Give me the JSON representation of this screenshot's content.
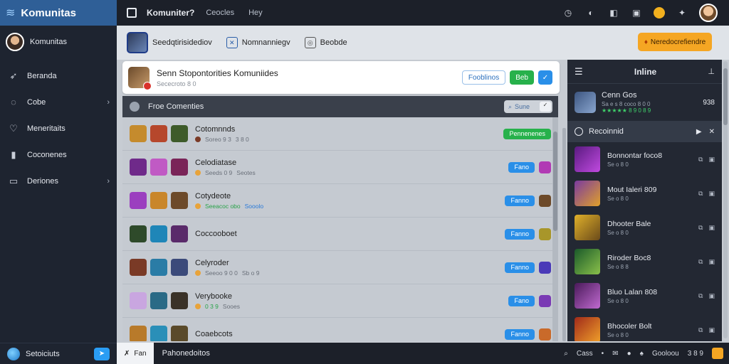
{
  "sidebar": {
    "brand": "Komunitas",
    "user_name": "Komunitas",
    "items": [
      {
        "label": "Beranda",
        "icon": "rocket-icon",
        "chevron": false
      },
      {
        "label": "Cobe",
        "icon": "chat-icon",
        "chevron": true
      },
      {
        "label": "Meneritaits",
        "icon": "heart-icon",
        "chevron": false
      },
      {
        "label": "Coconenes",
        "icon": "chart-icon",
        "chevron": false
      },
      {
        "label": "Deriones",
        "icon": "folder-icon",
        "chevron": true
      }
    ],
    "footer_label": "Setoiciuts"
  },
  "topbar": {
    "title": "Komuniter?",
    "link1": "Ceocles",
    "link2": "Hey"
  },
  "toolbar": {
    "item1": "Seedqtirisidediov",
    "item2": "Nomnanniegv",
    "item3": "Beobde",
    "cta_label": "Neredocrefiendre"
  },
  "community": {
    "title": "Senn Stopontorities Komuniides",
    "subtitle": "Sececroto 8 0",
    "btn_outline": "Fooblinos",
    "btn_green": "Beb",
    "btn_check": "✓"
  },
  "friends": {
    "header": "Froe Comenties",
    "search_placeholder": "Sune",
    "rows": [
      {
        "name": "Cotomnnds",
        "meta": [
          "Soreo 9 3",
          "3 8 0"
        ],
        "button": "Pennenenes",
        "button_type": "green",
        "games": [
          "#c58b2d",
          "#b6472c",
          "#3e5b2a"
        ],
        "mini": ""
      },
      {
        "name": "Celodiatase",
        "meta": [
          "Seeds 0 9",
          "Seotes"
        ],
        "button": "Fano",
        "button_type": "blue",
        "games": [
          "#6f2a8a",
          "#c05ac4",
          "#7a2458"
        ],
        "mini": "#b13ab4"
      },
      {
        "name": "Cotydeote",
        "meta": [
          "Seeacoc obo",
          "Sooolo"
        ],
        "button": "Fanno",
        "button_type": "blue",
        "games": [
          "#9b3fbf",
          "#c9862a",
          "#6d4a2a"
        ],
        "mini": "#6d4a2a"
      },
      {
        "name": "Coccooboet",
        "meta": [],
        "button": "Fanno",
        "button_type": "blue",
        "games": [
          "#2e4a2a",
          "#1f86b8",
          "#5a2a6a"
        ],
        "mini": "#a8962a"
      },
      {
        "name": "Celyroder",
        "meta": [
          "Seeoo 9 0 0",
          "Sb o 9"
        ],
        "button": "Fanno",
        "button_type": "blue",
        "games": [
          "#7a3a26",
          "#2a7ca6",
          "#3b4a7a"
        ],
        "mini": "#4a3ab8"
      },
      {
        "name": "Verybooke",
        "meta": [
          "0 3 9",
          "Sooes"
        ],
        "button": "Fano",
        "button_type": "blue",
        "games": [
          "#c9a6e0",
          "#2a6a86",
          "#3a3228"
        ],
        "mini": "#7a3ab4"
      },
      {
        "name": "Coaebcots",
        "meta": [],
        "button": "Fanno",
        "button_type": "blue",
        "games": [
          "#b87a2a",
          "#2a8fb8",
          "#5a4a2a"
        ],
        "mini": "#c96a2a"
      }
    ]
  },
  "right_panel": {
    "title": "Inline",
    "me": {
      "name": "Cenn Gos",
      "meta": "Sa e s 8 coco 8 0 0",
      "stars": "★★★★★ 8 9 0 8 9",
      "num": "938"
    },
    "section": "Recoinnid",
    "items": [
      {
        "name": "Bonnontar foco8",
        "meta": "Se o 8 0",
        "color": "#8a2ab0"
      },
      {
        "name": "Mout Ialeri 809",
        "meta": "Se o 8 0",
        "color": "#c98a2a"
      },
      {
        "name": "Dhooter Bale",
        "meta": "Se o 8 0",
        "color": "#a8862a"
      },
      {
        "name": "Riroder Boc8",
        "meta": "Se o 8 8",
        "color": "#2a7a3a"
      },
      {
        "name": "Bluo Lalan 808",
        "meta": "Se o 8 0",
        "color": "#7a2a8a"
      },
      {
        "name": "Bhocoler Bolt",
        "meta": "Se o 8 0",
        "color": "#c9552a"
      }
    ]
  },
  "bottombar": {
    "tab_label": "Fan",
    "text": "Pahonedoitos",
    "status1": "Cass",
    "status2": "Gooloou",
    "status3": "3 8 9"
  }
}
